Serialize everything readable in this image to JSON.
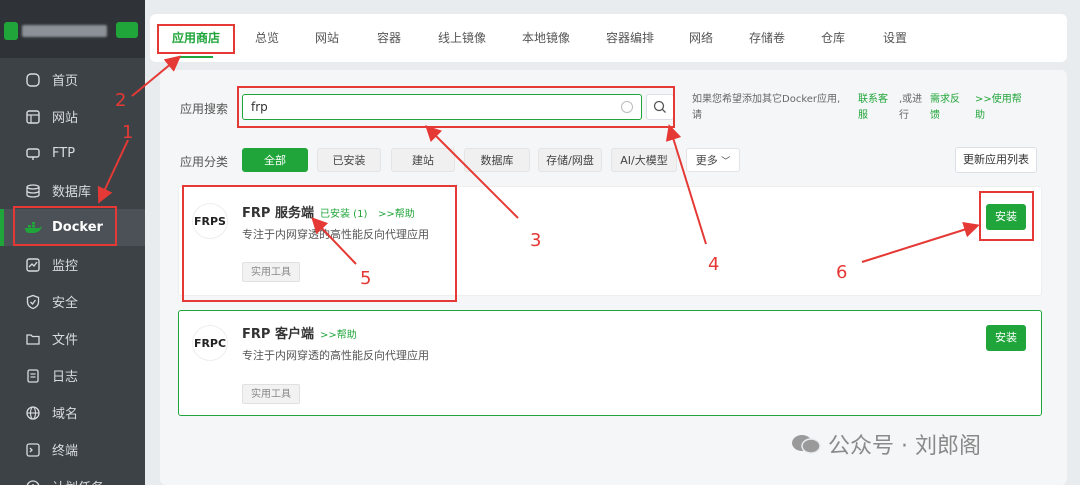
{
  "sidebar": {
    "items": [
      {
        "label": "首页",
        "icon": "home-icon"
      },
      {
        "label": "网站",
        "icon": "website-icon"
      },
      {
        "label": "FTP",
        "icon": "ftp-icon"
      },
      {
        "label": "数据库",
        "icon": "database-icon"
      },
      {
        "label": "Docker",
        "icon": "docker-icon"
      },
      {
        "label": "监控",
        "icon": "monitor-icon"
      },
      {
        "label": "安全",
        "icon": "shield-icon"
      },
      {
        "label": "文件",
        "icon": "folder-icon"
      },
      {
        "label": "日志",
        "icon": "log-icon"
      },
      {
        "label": "域名",
        "icon": "globe-icon"
      },
      {
        "label": "终端",
        "icon": "terminal-icon"
      },
      {
        "label": "计划任务",
        "icon": "clock-icon"
      }
    ]
  },
  "tabs": [
    "应用商店",
    "总览",
    "网站",
    "容器",
    "线上镜像",
    "本地镜像",
    "容器编排",
    "网络",
    "存储卷",
    "仓库",
    "设置"
  ],
  "search": {
    "label": "应用搜索",
    "value": "frp",
    "hint_prefix": "如果您希望添加其它Docker应用,",
    "hint_prefix_2": "请",
    "link_feedback": "联系客",
    "link_feedback_2": "服",
    "or_text": ",或进",
    "or_text_2": "行",
    "link_request": "需求反",
    "link_request_2": "馈",
    "link_help": ">>使用帮",
    "link_help_2": "助"
  },
  "category": {
    "label": "应用分类",
    "chips": [
      "全部",
      "已安装",
      "建站",
      "数据库",
      "存储/网盘",
      "AI/大模型",
      "更多"
    ],
    "update_button": "更新应用列表"
  },
  "apps": [
    {
      "logo": "FRPS",
      "name": "FRP 服务端",
      "installed": "已安装 (1)",
      "help": ">>帮助",
      "desc": "专注于内网穿透的高性能反向代理应用",
      "tag": "实用工具",
      "install": "安装"
    },
    {
      "logo": "FRPC",
      "name": "FRP 客户端",
      "help": ">>帮助",
      "desc": "专注于内网穿透的高性能反向代理应用",
      "tag": "实用工具",
      "install": "安装"
    }
  ],
  "annotations": [
    "1",
    "2",
    "3",
    "4",
    "5",
    "6"
  ],
  "watermark": "公众号 · 刘郎阁",
  "colors": {
    "accent": "#20a53a",
    "annotation": "#e53935",
    "sidebar": "#3d4246"
  }
}
